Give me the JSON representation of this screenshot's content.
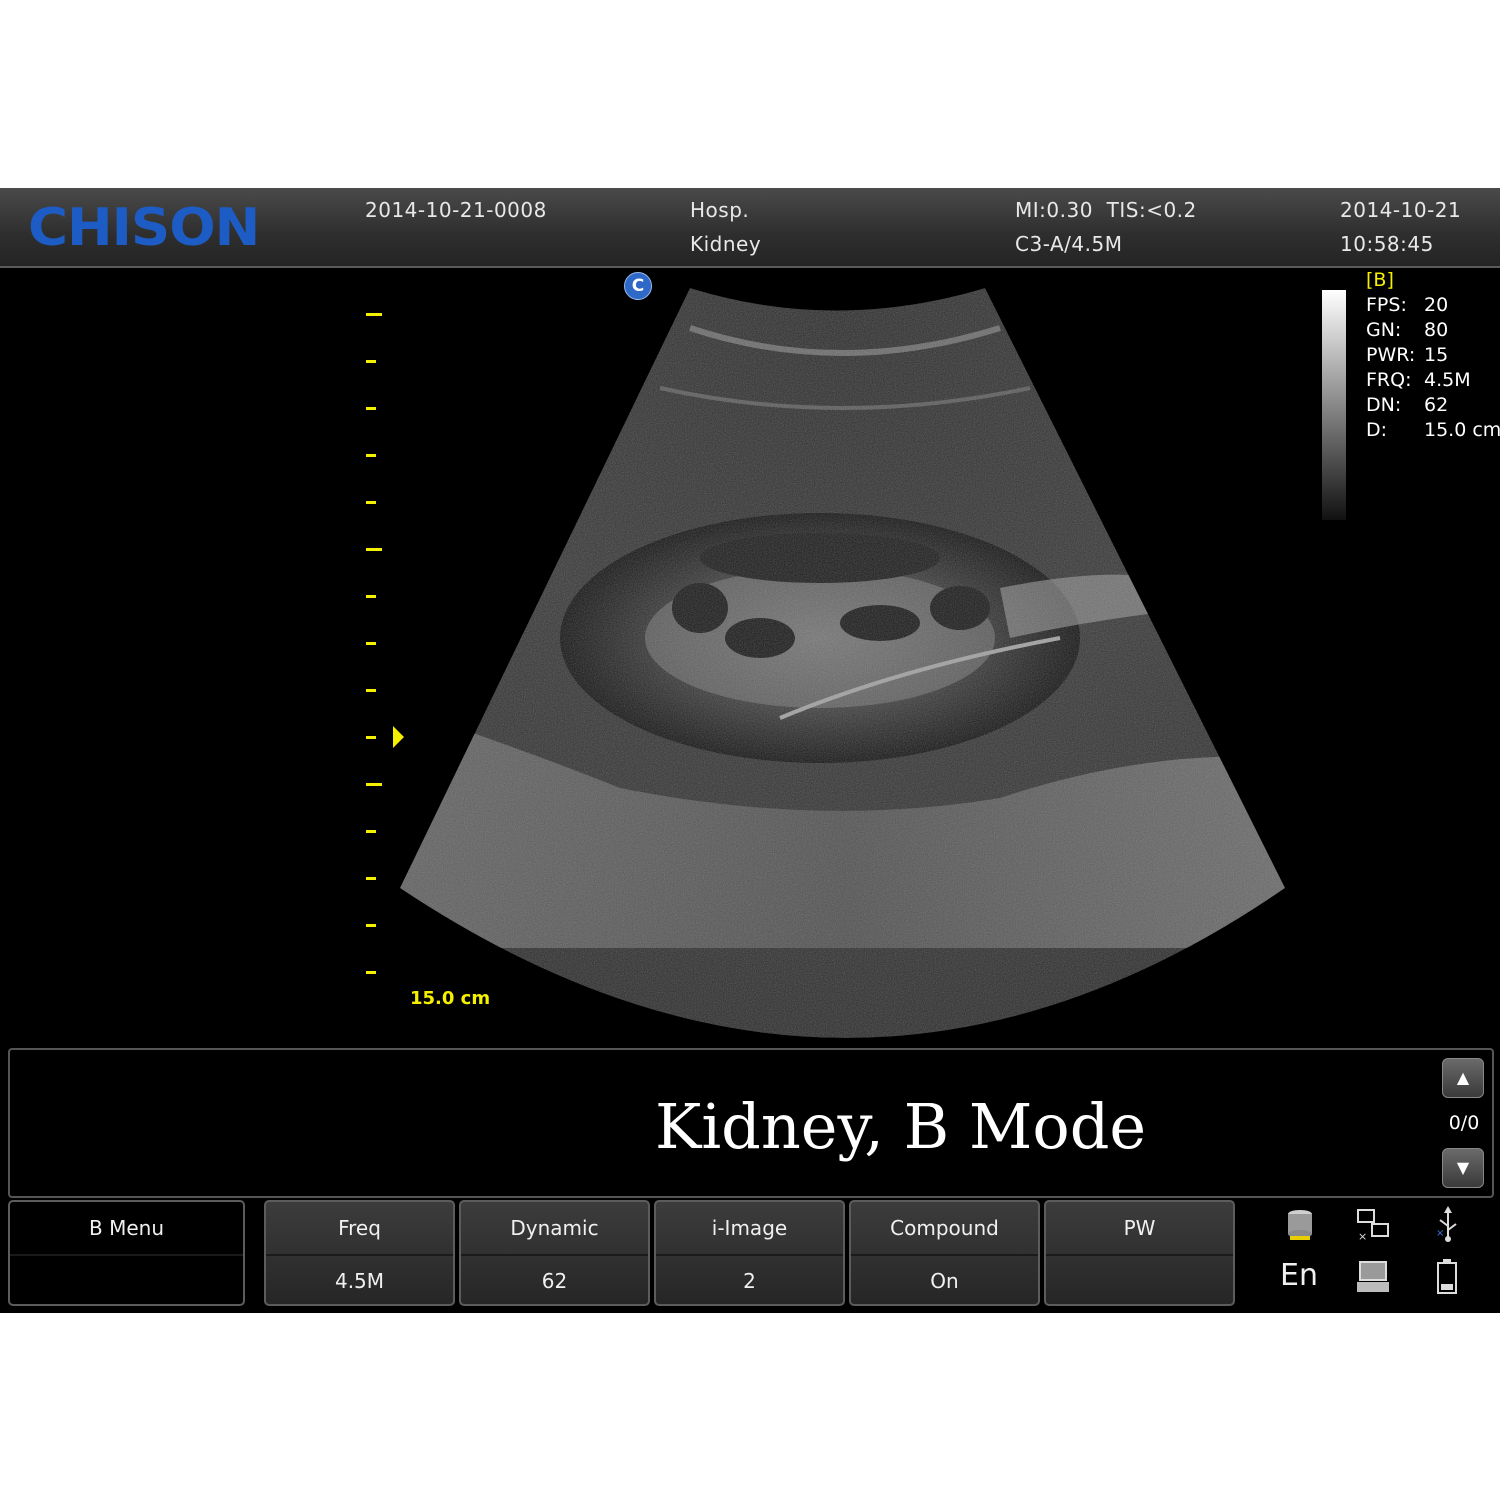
{
  "header": {
    "logo": "CHISON",
    "exam_id": "2014-10-21-0008",
    "hospital": "Hosp.",
    "exam_type": "Kidney",
    "mi_tis": "MI:0.30  TIS:<0.2",
    "probe": "C3-A/4.5M",
    "date": "2014-10-21",
    "time": "10:58:45"
  },
  "image": {
    "orientation_badge": "C",
    "depth_label": "15.0 cm"
  },
  "params": {
    "mode": "[B]",
    "rows": [
      {
        "key": "FPS:",
        "value": "20"
      },
      {
        "key": "GN:",
        "value": "80"
      },
      {
        "key": "PWR:",
        "value": "15"
      },
      {
        "key": "FRQ:",
        "value": "4.5M"
      },
      {
        "key": "DN:",
        "value": "62"
      },
      {
        "key": "D:",
        "value": "15.0 cm"
      }
    ]
  },
  "comment": {
    "text": "Kidney, B Mode",
    "page": "0/0",
    "up_icon": "triangle-up-icon",
    "down_icon": "triangle-down-icon"
  },
  "softkeys": {
    "menu_label": "B Menu",
    "buttons": [
      {
        "label": "Freq",
        "value": "4.5M"
      },
      {
        "label": "Dynamic",
        "value": "62"
      },
      {
        "label": "i-Image",
        "value": "2"
      },
      {
        "label": "Compound",
        "value": "On"
      },
      {
        "label": "PW",
        "value": ""
      }
    ]
  },
  "status": {
    "language": "En",
    "icons": [
      "disk-icon",
      "network-icon",
      "usb-icon",
      "printer-icon",
      "battery-icon"
    ]
  },
  "colors": {
    "accent_yellow": "#f4f000",
    "logo_blue": "#1d5cc4",
    "badge_blue": "#2f69c8"
  }
}
